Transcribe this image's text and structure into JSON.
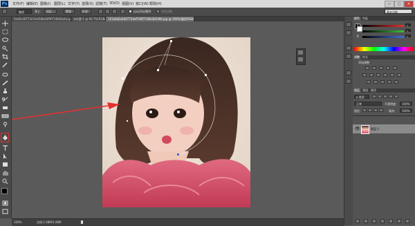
{
  "app": {
    "logo": "Ps"
  },
  "menu": {
    "items": [
      "文件(F)",
      "编辑(E)",
      "图像(I)",
      "图层(L)",
      "文字(Y)",
      "选择(S)",
      "滤镜(T)",
      "3D(D)",
      "视图(V)",
      "窗口(W)",
      "帮助(H)"
    ],
    "window_buttons": [
      "—",
      "□",
      "✕"
    ]
  },
  "options": {
    "mode_value": "路径",
    "make_label": "建立：",
    "selection_btn": "选区...",
    "mask_btn": "蒙版",
    "shape_btn": "形状",
    "auto_add_delete": "自动添加/删除",
    "align_edges": "对齐边缘",
    "workspace": "基本功能"
  },
  "tabs": [
    {
      "label": "5ed5cd0773e7eef18b44f9f77d0d5a4a.jpg @ 100% (RGB/8) ×"
    },
    {
      "label": "未标题-1 @ 66.7%(RGB/8) ×"
    },
    {
      "label": "115a4d2e4d07734ef7d0f77d6b3b5d9b.jpg @ 100%(路径/RGB/8) ×"
    }
  ],
  "status": {
    "zoom": "100%",
    "doc": "文档:1.08M/1.08M"
  },
  "panels": {
    "color": {
      "tabs": [
        "颜色",
        "色板"
      ],
      "channels": [
        "R",
        "G",
        "B"
      ],
      "values": [
        "0",
        "0",
        "0"
      ]
    },
    "adjust": {
      "tabs": [
        "调整",
        "样式"
      ],
      "title": "添加调整"
    },
    "layers": {
      "tabs": [
        "图层",
        "通道",
        "路径"
      ],
      "kind": "ρ 类型",
      "blend": "正常",
      "opacity_label": "不透明度:",
      "opacity": "100%",
      "lock_label": "锁定:",
      "fill_label": "填充:",
      "fill": "100%",
      "layer_name": "图层 0"
    }
  },
  "colors": {
    "accent_red": "#e53030",
    "r_slider": "#e53030",
    "g_slider": "#3fbf3f",
    "b_slider": "#3f6fdf"
  }
}
